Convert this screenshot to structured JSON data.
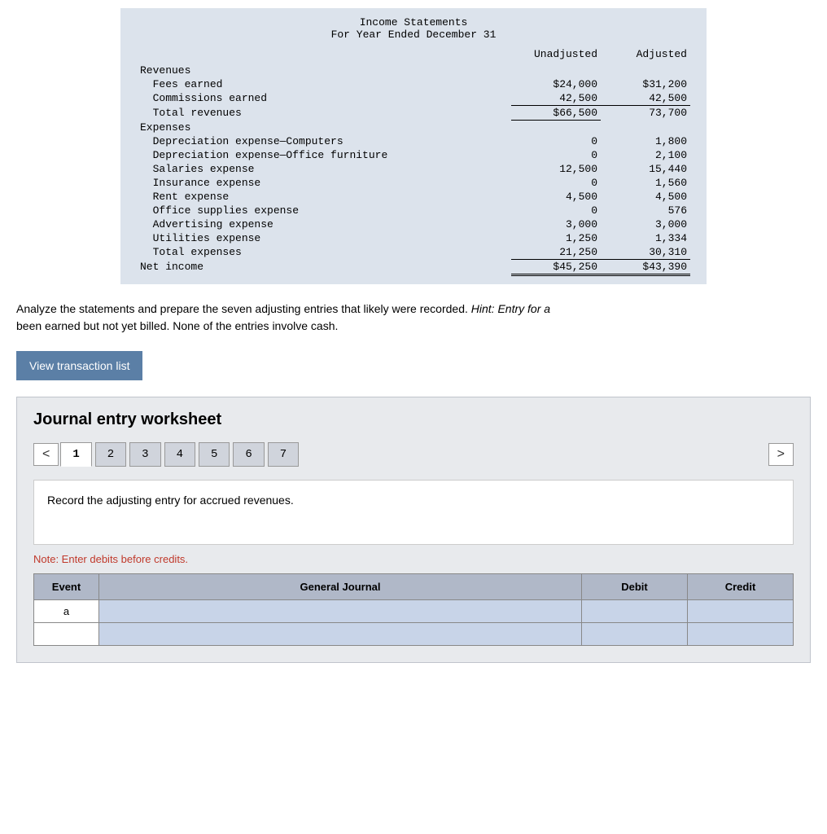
{
  "income_statement": {
    "title_line1": "Income Statements",
    "title_line2": "For Year Ended December 31",
    "col_unadj": "Unadjusted",
    "col_adj": "Adjusted",
    "sections": {
      "revenues_label": "Revenues",
      "fees_earned_label": "  Fees earned",
      "fees_earned_unadj": "$24,000",
      "fees_earned_adj": "$31,200",
      "commissions_label": "  Commissions earned",
      "commissions_unadj": "42,500",
      "commissions_adj": "42,500",
      "total_revenues_label": "  Total revenues",
      "total_revenues_unadj": "$66,500",
      "total_revenues_adj": "73,700",
      "expenses_label": "Expenses",
      "dep_computers_label": "  Depreciation expense—Computers",
      "dep_computers_unadj": "0",
      "dep_computers_adj": "1,800",
      "dep_furniture_label": "  Depreciation expense—Office furniture",
      "dep_furniture_unadj": "0",
      "dep_furniture_adj": "2,100",
      "salaries_label": "  Salaries expense",
      "salaries_unadj": "12,500",
      "salaries_adj": "15,440",
      "insurance_label": "  Insurance expense",
      "insurance_unadj": "0",
      "insurance_adj": "1,560",
      "rent_label": "  Rent expense",
      "rent_unadj": "4,500",
      "rent_adj": "4,500",
      "office_supplies_label": "  Office supplies expense",
      "office_supplies_unadj": "0",
      "office_supplies_adj": "576",
      "advertising_label": "  Advertising expense",
      "advertising_unadj": "3,000",
      "advertising_adj": "3,000",
      "utilities_label": "  Utilities expense",
      "utilities_unadj": "1,250",
      "utilities_adj": "1,334",
      "total_expenses_label": "  Total expenses",
      "total_expenses_unadj": "21,250",
      "total_expenses_adj": "30,310",
      "net_income_label": "Net income",
      "net_income_unadj": "$45,250",
      "net_income_adj": "$43,390"
    }
  },
  "analyze": {
    "text": "Analyze the statements and prepare the seven adjusting entries that likely were recorded. ",
    "hint_label": "Hint:",
    "hint_text": " Entry for a",
    "text2": "been earned but not yet billed. None of the entries involve cash."
  },
  "view_transaction_btn": "View transaction list",
  "journal_worksheet": {
    "title": "Journal entry worksheet",
    "tabs": [
      {
        "label": "1",
        "active": true
      },
      {
        "label": "2",
        "active": false
      },
      {
        "label": "3",
        "active": false
      },
      {
        "label": "4",
        "active": false
      },
      {
        "label": "5",
        "active": false
      },
      {
        "label": "6",
        "active": false
      },
      {
        "label": "7",
        "active": false
      }
    ],
    "prev_arrow": "<",
    "next_arrow": ">",
    "instruction": "Record the adjusting entry for accrued revenues.",
    "note": "Note: Enter debits before credits.",
    "table": {
      "col_event": "Event",
      "col_journal": "General Journal",
      "col_debit": "Debit",
      "col_credit": "Credit",
      "rows": [
        {
          "event": "a",
          "journal": "",
          "debit": "",
          "credit": ""
        },
        {
          "event": "",
          "journal": "",
          "debit": "",
          "credit": ""
        }
      ]
    }
  }
}
